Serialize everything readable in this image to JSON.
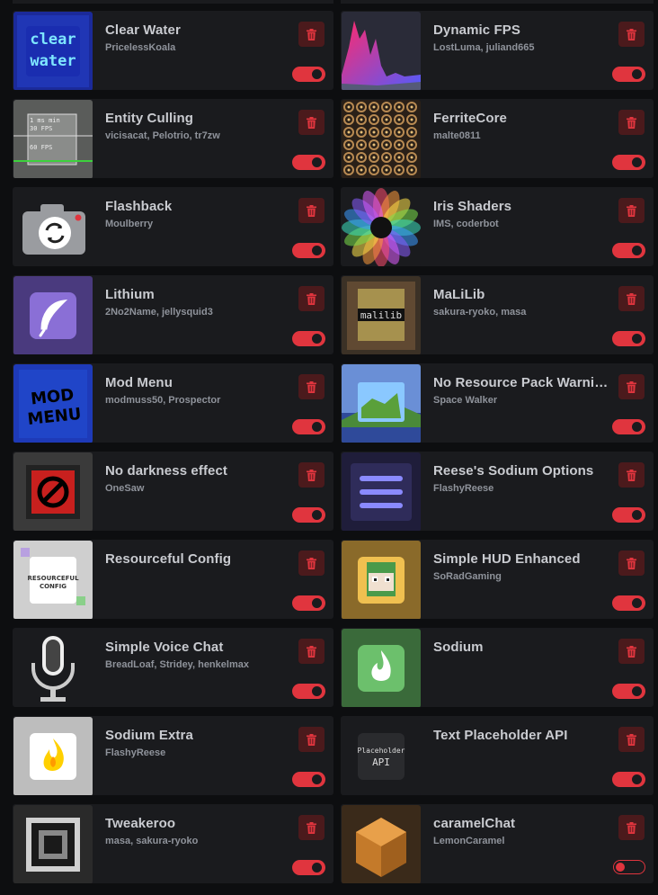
{
  "colors": {
    "accent": "#e0353e",
    "card_bg": "#1a1b1e",
    "page_bg": "#0d0e10",
    "delete_bg": "#4b1a1c"
  },
  "mods": [
    {
      "name": "Clear Water",
      "authors": "PricelessKoala",
      "enabled": true,
      "icon": "clear-water-icon",
      "logo_text": "clear water"
    },
    {
      "name": "Dynamic FPS",
      "authors": "LostLuma, juliand665",
      "enabled": true,
      "icon": "dynamic-fps-icon"
    },
    {
      "name": "Entity Culling",
      "authors": "vicisacat, Pelotrio, tr7zw",
      "enabled": true,
      "icon": "entity-culling-icon",
      "logo_text": "1 ms min · 30 FPS · 60 FPS"
    },
    {
      "name": "FerriteCore",
      "authors": "malte0811",
      "enabled": true,
      "icon": "ferritecore-icon"
    },
    {
      "name": "Flashback",
      "authors": "Moulberry",
      "enabled": true,
      "icon": "camera-icon"
    },
    {
      "name": "Iris Shaders",
      "authors": "IMS, coderbot",
      "enabled": true,
      "icon": "iris-icon"
    },
    {
      "name": "Lithium",
      "authors": "2No2Name, jellysquid3",
      "enabled": true,
      "icon": "feather-icon"
    },
    {
      "name": "MaLiLib",
      "authors": "sakura-ryoko, masa",
      "enabled": true,
      "icon": "malilib-icon",
      "logo_text": "malilib"
    },
    {
      "name": "Mod Menu",
      "authors": "modmuss50, Prospector",
      "enabled": true,
      "icon": "mod-menu-icon",
      "logo_text": "MOD MENU"
    },
    {
      "name": "No Resource Pack Warnin...",
      "authors": "Space Walker",
      "enabled": true,
      "icon": "landscape-icon"
    },
    {
      "name": "No darkness effect",
      "authors": "OneSaw",
      "enabled": true,
      "icon": "no-darkness-icon"
    },
    {
      "name": "Reese's Sodium Options",
      "authors": "FlashyReese",
      "enabled": true,
      "icon": "sodium-options-icon"
    },
    {
      "name": "Resourceful Config",
      "authors": "",
      "enabled": true,
      "icon": "resourceful-config-icon",
      "logo_text": "RESOURCEFUL CONFIG"
    },
    {
      "name": "Simple HUD Enhanced",
      "authors": "SoRadGaming",
      "enabled": true,
      "icon": "hud-face-icon"
    },
    {
      "name": "Simple Voice Chat",
      "authors": "BreadLoaf, Stridey, henkelmax",
      "enabled": true,
      "icon": "microphone-icon"
    },
    {
      "name": "Sodium",
      "authors": "",
      "enabled": true,
      "icon": "sodium-flame-icon"
    },
    {
      "name": "Sodium Extra",
      "authors": "FlashyReese",
      "enabled": true,
      "icon": "sodium-extra-flame-icon"
    },
    {
      "name": "Text Placeholder API",
      "authors": "",
      "enabled": true,
      "icon": "placeholder-api-icon",
      "logo_text": "Placeholder API"
    },
    {
      "name": "Tweakeroo",
      "authors": "masa, sakura-ryoko",
      "enabled": true,
      "icon": "tweakeroo-icon"
    },
    {
      "name": "caramelChat",
      "authors": "LemonCaramel",
      "enabled": false,
      "icon": "caramel-icon"
    }
  ]
}
